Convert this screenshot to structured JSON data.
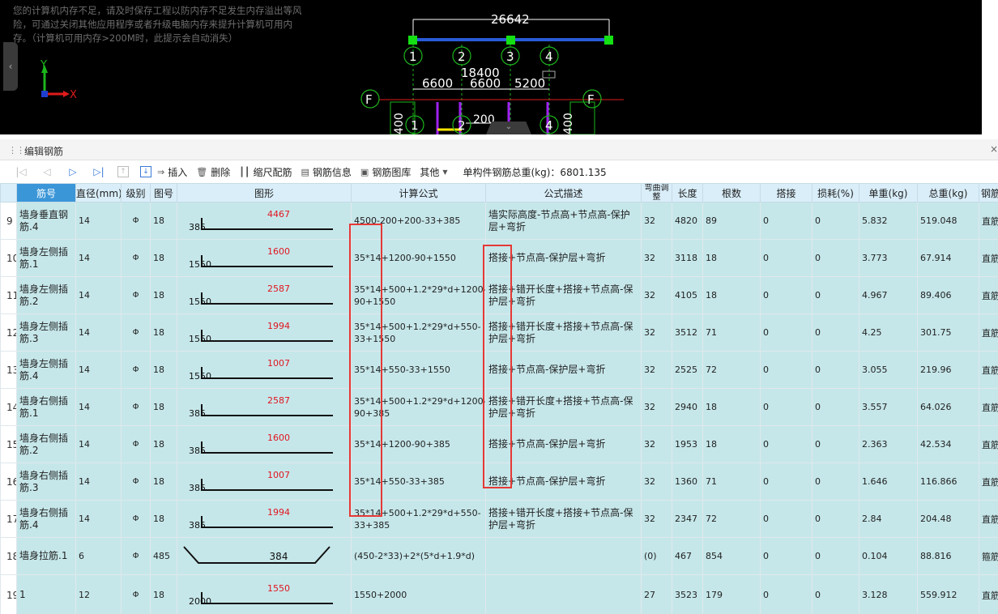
{
  "cad": {
    "warning_lines": [
      "您的计算机内存不足，请及时保存工程以防内存不足发生内存溢出等风",
      "险，可通过关闭其他应用程序或者升级电脑内存来提升计算机可用内",
      "存。（计算机可用内存>200M时，此提示会自动消失）"
    ],
    "axis_y": "Y",
    "axis_x": "X",
    "dim_total": "26642",
    "dim_mid": "18400",
    "dims": [
      "6600",
      "6600",
      "5200"
    ],
    "dim_bottom": "200",
    "grid_numbers": [
      "1",
      "2",
      "3",
      "4"
    ],
    "grid_letter": "F",
    "side_dims": [
      "400",
      "400"
    ],
    "left_handle_icon": "chevron-left-icon",
    "collapse_icon": "chevron-down-icon"
  },
  "panel": {
    "title": "编辑钢筋",
    "close_icon": "close-icon"
  },
  "toolbar": {
    "insert": "插入",
    "delete": "删除",
    "scale_rebar": "缩尺配筋",
    "rebar_info": "钢筋信息",
    "rebar_library": "钢筋图库",
    "other": "其他",
    "total_weight_label": "单构件钢筋总重(kg)：6801.135"
  },
  "table": {
    "headers": [
      "",
      "筋号",
      "直径(mm)",
      "级别",
      "图号",
      "图形",
      "计算公式",
      "公式描述",
      "弯曲调整",
      "长度",
      "根数",
      "搭接",
      "损耗(%)",
      "单重(kg)",
      "总重(kg)",
      "钢筋"
    ],
    "rows": [
      {
        "rn": "9",
        "name": "墙身垂直钢筋.4",
        "dia": "14",
        "lvl": "Φ",
        "fig": "18",
        "shape_left": "385",
        "shape_mid": "4467",
        "formula": "4500-200+200-33+385",
        "desc": "墙实际高度-节点高+节点高-保护层+弯折",
        "bend": "32",
        "len": "4820",
        "count": "89",
        "lap": "0",
        "loss": "0",
        "unit": "5.832",
        "total": "519.048",
        "type": "直筋"
      },
      {
        "rn": "10",
        "name": "墙身左侧插筋.1",
        "dia": "14",
        "lvl": "Φ",
        "fig": "18",
        "shape_left": "1550",
        "shape_mid": "1600",
        "formula": "35*14+1200-90+1550",
        "desc": "搭接+节点高-保护层+弯折",
        "bend": "32",
        "len": "3118",
        "count": "18",
        "lap": "0",
        "loss": "0",
        "unit": "3.773",
        "total": "67.914",
        "type": "直筋"
      },
      {
        "rn": "11",
        "name": "墙身左侧插筋.2",
        "dia": "14",
        "lvl": "Φ",
        "fig": "18",
        "shape_left": "1550",
        "shape_mid": "2587",
        "formula": "35*14+500+1.2*29*d+1200-90+1550",
        "desc": "搭接+错开长度+搭接+节点高-保护层+弯折",
        "bend": "32",
        "len": "4105",
        "count": "18",
        "lap": "0",
        "loss": "0",
        "unit": "4.967",
        "total": "89.406",
        "type": "直筋"
      },
      {
        "rn": "12",
        "name": "墙身左侧插筋.3",
        "dia": "14",
        "lvl": "Φ",
        "fig": "18",
        "shape_left": "1550",
        "shape_mid": "1994",
        "formula": "35*14+500+1.2*29*d+550-33+1550",
        "desc": "搭接+错开长度+搭接+节点高-保护层+弯折",
        "bend": "32",
        "len": "3512",
        "count": "71",
        "lap": "0",
        "loss": "0",
        "unit": "4.25",
        "total": "301.75",
        "type": "直筋"
      },
      {
        "rn": "13",
        "name": "墙身左侧插筋.4",
        "dia": "14",
        "lvl": "Φ",
        "fig": "18",
        "shape_left": "1550",
        "shape_mid": "1007",
        "formula": "35*14+550-33+1550",
        "desc": "搭接+节点高-保护层+弯折",
        "bend": "32",
        "len": "2525",
        "count": "72",
        "lap": "0",
        "loss": "0",
        "unit": "3.055",
        "total": "219.96",
        "type": "直筋"
      },
      {
        "rn": "14",
        "name": "墙身右侧插筋.1",
        "dia": "14",
        "lvl": "Φ",
        "fig": "18",
        "shape_left": "385",
        "shape_mid": "2587",
        "formula": "35*14+500+1.2*29*d+1200-90+385",
        "desc": "搭接+错开长度+搭接+节点高-保护层+弯折",
        "bend": "32",
        "len": "2940",
        "count": "18",
        "lap": "0",
        "loss": "0",
        "unit": "3.557",
        "total": "64.026",
        "type": "直筋"
      },
      {
        "rn": "15",
        "name": "墙身右侧插筋.2",
        "dia": "14",
        "lvl": "Φ",
        "fig": "18",
        "shape_left": "385",
        "shape_mid": "1600",
        "formula": "35*14+1200-90+385",
        "desc": "搭接+节点高-保护层+弯折",
        "bend": "32",
        "len": "1953",
        "count": "18",
        "lap": "0",
        "loss": "0",
        "unit": "2.363",
        "total": "42.534",
        "type": "直筋"
      },
      {
        "rn": "16",
        "name": "墙身右侧插筋.3",
        "dia": "14",
        "lvl": "Φ",
        "fig": "18",
        "shape_left": "385",
        "shape_mid": "1007",
        "formula": "35*14+550-33+385",
        "desc": "搭接+节点高-保护层+弯折",
        "bend": "32",
        "len": "1360",
        "count": "71",
        "lap": "0",
        "loss": "0",
        "unit": "1.646",
        "total": "116.866",
        "type": "直筋"
      },
      {
        "rn": "17",
        "name": "墙身右侧插筋.4",
        "dia": "14",
        "lvl": "Φ",
        "fig": "18",
        "shape_left": "385",
        "shape_mid": "1994",
        "formula": "35*14+500+1.2*29*d+550-33+385",
        "desc": "搭接+错开长度+搭接+节点高-保护层+弯折",
        "bend": "32",
        "len": "2347",
        "count": "72",
        "lap": "0",
        "loss": "0",
        "unit": "2.84",
        "total": "204.48",
        "type": "直筋"
      },
      {
        "rn": "18",
        "name": "墙身拉筋.1",
        "dia": "6",
        "lvl": "Φ",
        "fig": "485",
        "shape_left": "",
        "shape_mid": "384",
        "formula": "(450-2*33)+2*(5*d+1.9*d)",
        "desc": "",
        "bend": "(0)",
        "len": "467",
        "count": "854",
        "lap": "0",
        "loss": "0",
        "unit": "0.104",
        "total": "88.816",
        "type": "箍筋"
      },
      {
        "rn": "19",
        "name": "1",
        "dia": "12",
        "lvl": "Φ",
        "fig": "18",
        "shape_left": "2000",
        "shape_mid": "1550",
        "formula": "1550+2000",
        "desc": "",
        "bend": "27",
        "len": "3523",
        "count": "179",
        "lap": "0",
        "loss": "0",
        "unit": "3.128",
        "total": "559.912",
        "type": "直筋"
      }
    ]
  },
  "colors": {
    "row_bg": "#c6e7ea",
    "header_bg": "#d9eef9",
    "key_header_bg": "#3b96d8",
    "highlight_box": "#e53935",
    "shape_value": "#e0151e"
  }
}
